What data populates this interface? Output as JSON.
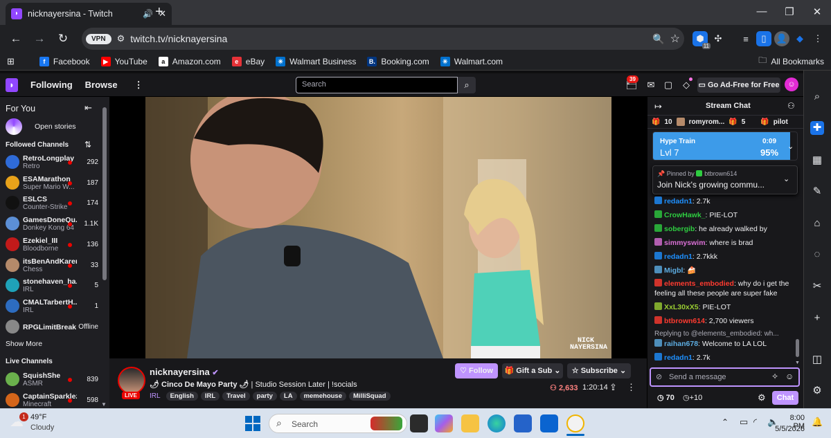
{
  "browser": {
    "tab_title": "nicknayersina - Twitch",
    "url": "twitch.tv/nicknayersina",
    "vpn_label": "VPN",
    "ext_badge": "11",
    "bookmarks": [
      {
        "label": "Facebook",
        "color": "#1877f2",
        "glyph": "f"
      },
      {
        "label": "YouTube",
        "color": "#ff0000",
        "glyph": "▶"
      },
      {
        "label": "Amazon.com",
        "color": "#ffffff",
        "glyph": "a"
      },
      {
        "label": "eBay",
        "color": "#e53238",
        "glyph": "e"
      },
      {
        "label": "Walmart Business",
        "color": "#0071ce",
        "glyph": "✳"
      },
      {
        "label": "Booking.com",
        "color": "#003580",
        "glyph": "B."
      },
      {
        "label": "Walmart.com",
        "color": "#0071ce",
        "glyph": "✳"
      }
    ],
    "all_bookmarks": "All Bookmarks"
  },
  "twitch_nav": {
    "following": "Following",
    "browse": "Browse",
    "search_placeholder": "Search",
    "notif_count": "39",
    "ad_free": "Go Ad-Free for Free"
  },
  "sidebar": {
    "for_you": "For You",
    "open_stories": "Open stories",
    "followed_channels": "Followed Channels",
    "followed": [
      {
        "name": "RetroLongplay",
        "game": "Retro",
        "viewers": "292",
        "color": "#2f6bd8"
      },
      {
        "name": "ESAMarathon",
        "game": "Super Mario W...",
        "viewers": "187",
        "color": "#e8a21a"
      },
      {
        "name": "ESLCS",
        "game": "Counter-Strike",
        "viewers": "174",
        "color": "#111111"
      },
      {
        "name": "GamesDoneQu...",
        "game": "Donkey Kong 64",
        "viewers": "1.1K",
        "color": "#5c8fd6"
      },
      {
        "name": "Ezekiel_III",
        "game": "Bloodborne",
        "viewers": "136",
        "color": "#c21a1a"
      },
      {
        "name": "itsBenAndKaren",
        "game": "Chess",
        "viewers": "33",
        "color": "#b58a6a"
      },
      {
        "name": "stonehaven_ha...",
        "game": "IRL",
        "viewers": "5",
        "color": "#1fa2b8"
      },
      {
        "name": "CMALTarbertH...",
        "game": "IRL",
        "viewers": "1",
        "color": "#2d6cc0"
      },
      {
        "name": "RPGLimitBreak",
        "game": "",
        "viewers": "Offline",
        "color": "#888888"
      }
    ],
    "show_more": "Show More",
    "live_channels": "Live Channels",
    "live": [
      {
        "name": "SquishShe",
        "game": "ASMR",
        "viewers": "839",
        "color": "#6ab04c"
      },
      {
        "name": "CaptainSparklez",
        "game": "Minecraft",
        "viewers": "598",
        "color": "#d4651a"
      }
    ]
  },
  "stream": {
    "channel": "nicknayersina",
    "title_prefix": "🌶 Cinco De Mayo Party 🌶",
    "title_rest": " | Studio Session Later | !socials",
    "category": "IRL",
    "tags": [
      "English",
      "IRL",
      "Travel",
      "party",
      "LA",
      "memehouse",
      "MilliSquad"
    ],
    "live_label": "LIVE",
    "follow": "Follow",
    "gift": "Gift a Sub",
    "subscribe": "Subscribe",
    "viewers": "2,633",
    "uptime": "1:20:14",
    "watermark": "NICK NAYERSINA"
  },
  "chat": {
    "title": "Stream Chat",
    "leader": [
      {
        "text": "10"
      },
      {
        "text": "romyrom..."
      },
      {
        "text": "5"
      },
      {
        "text": "pilot"
      }
    ],
    "hype_train": {
      "label": "Hype Train",
      "level": "Lvl 7",
      "time": "0:09",
      "percent": "95%",
      "progress": 0.95
    },
    "pinned": {
      "by_label": "Pinned by",
      "by": "btbrown614",
      "text": "Join Nick's growing commu..."
    },
    "messages": [
      {
        "user": "redadn1",
        "color": "#1e90ff",
        "text": ": 2.7k"
      },
      {
        "user": "CrowHawk_",
        "color": "#2ecc40",
        "text": ": PIE-LOT"
      },
      {
        "user": "sobergib",
        "color": "#2ecc40",
        "text": ": he already walked by"
      },
      {
        "user": "simmyswim",
        "color": "#da70d6",
        "text": ": where is brad"
      },
      {
        "user": "redadn1",
        "color": "#1e90ff",
        "text": ": 2.7kkk"
      },
      {
        "user": "Migbl",
        "color": "#5dade2",
        "text": ": 🍰"
      },
      {
        "user": "elements_embodied",
        "color": "#ff3b30",
        "text": ": why do i get the feeling all these people are super fake"
      },
      {
        "user": "XxL30xX5",
        "color": "#9acd32",
        "text": ": PIE-LOT"
      },
      {
        "user": "btbrown614",
        "color": "#ff3b30",
        "text": ": 2,700 viewers"
      },
      {
        "user": "raihan678",
        "color": "#5dade2",
        "text": ": Welcome to LA LOL",
        "reply": "Replying to @elements_embodied: wh..."
      },
      {
        "user": "redadn1",
        "color": "#1e90ff",
        "text": ": 2.7k"
      }
    ],
    "input_placeholder": "Send a message",
    "points": "70",
    "points_plus": "+10",
    "chat_button": "Chat"
  },
  "taskbar": {
    "temp": "49°F",
    "weather": "Cloudy",
    "weather_badge": "1",
    "search": "Search",
    "time": "8:00 PM",
    "date": "5/5/2026"
  }
}
